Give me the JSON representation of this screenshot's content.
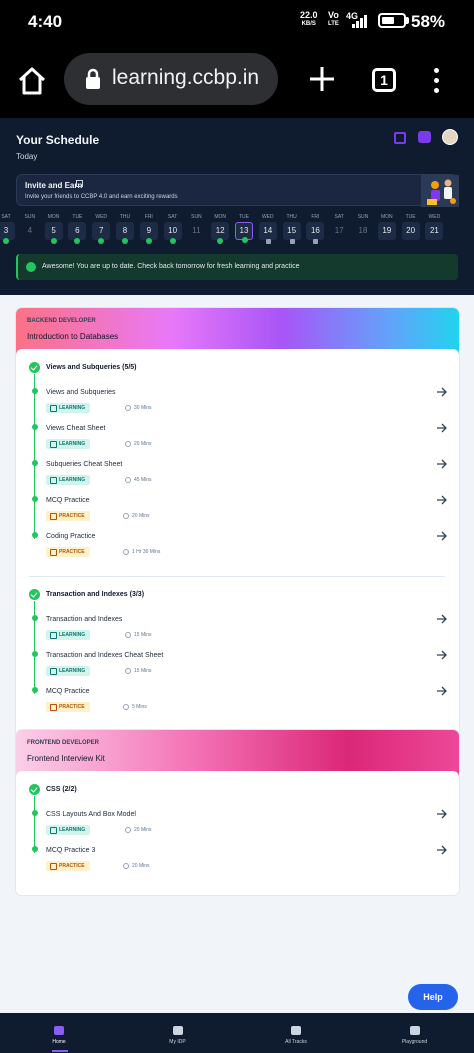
{
  "status_bar": {
    "time": "4:40",
    "speed_value": "22.0",
    "speed_unit": "KB/S",
    "volte_top": "Vo",
    "volte_bottom": "LTE",
    "network": "4G",
    "battery_percent": "58%",
    "battery_level": 0.58
  },
  "browser": {
    "url": "learning.ccbp.in",
    "tab_count": "1"
  },
  "schedule": {
    "title": "Your Schedule",
    "subtitle": "Today",
    "invite_title": "Invite and Earn",
    "invite_desc": "Invite your friends to CCBP 4.0 and earn exciting rewards",
    "days": [
      {
        "name": "SAT",
        "num": "3",
        "state": "done"
      },
      {
        "name": "SUN",
        "num": "4",
        "state": "off"
      },
      {
        "name": "MON",
        "num": "5",
        "state": "done"
      },
      {
        "name": "TUE",
        "num": "6",
        "state": "done"
      },
      {
        "name": "WED",
        "num": "7",
        "state": "done"
      },
      {
        "name": "THU",
        "num": "8",
        "state": "done"
      },
      {
        "name": "FRI",
        "num": "9",
        "state": "done"
      },
      {
        "name": "SAT",
        "num": "10",
        "state": "done"
      },
      {
        "name": "SUN",
        "num": "11",
        "state": "off"
      },
      {
        "name": "MON",
        "num": "12",
        "state": "done"
      },
      {
        "name": "TUE",
        "num": "13",
        "state": "today"
      },
      {
        "name": "WED",
        "num": "14",
        "state": "locked"
      },
      {
        "name": "THU",
        "num": "15",
        "state": "locked"
      },
      {
        "name": "FRI",
        "num": "16",
        "state": "locked"
      },
      {
        "name": "SAT",
        "num": "17",
        "state": "off"
      },
      {
        "name": "SUN",
        "num": "18",
        "state": "off"
      },
      {
        "name": "MON",
        "num": "19",
        "state": "plain"
      },
      {
        "name": "TUE",
        "num": "20",
        "state": "plain"
      },
      {
        "name": "WED",
        "num": "21",
        "state": "plain"
      }
    ],
    "status_message": "Awesome! You are up to date. Check back tomorrow for fresh learning and practice"
  },
  "cards": [
    {
      "category": "BACKEND DEVELOPER",
      "title": "Introduction to Databases",
      "sections": [
        {
          "title": "Views and Subqueries (5/5)",
          "items": [
            {
              "title": "Views and Subqueries",
              "type": "LEARNING",
              "duration": "30 Mins"
            },
            {
              "title": "Views Cheat Sheet",
              "type": "LEARNING",
              "duration": "20 Mins"
            },
            {
              "title": "Subqueries Cheat Sheet",
              "type": "LEARNING",
              "duration": "45 Mins"
            },
            {
              "title": "MCQ Practice",
              "type": "PRACTICE",
              "duration": "20 Mins"
            },
            {
              "title": "Coding Practice",
              "type": "PRACTICE",
              "duration": "1 Hr 30 Mins"
            }
          ]
        },
        {
          "title": "Transaction and Indexes (3/3)",
          "items": [
            {
              "title": "Transaction and Indexes",
              "type": "LEARNING",
              "duration": "15 Mins"
            },
            {
              "title": "Transaction and Indexes Cheat Sheet",
              "type": "LEARNING",
              "duration": "15 Mins"
            },
            {
              "title": "MCQ Practice",
              "type": "PRACTICE",
              "duration": "5 Mins"
            }
          ]
        }
      ]
    },
    {
      "category": "FRONTEND DEVELOPER",
      "title": "Frontend Interview Kit",
      "sections": [
        {
          "title": "CSS (2/2)",
          "items": [
            {
              "title": "CSS Layouts And Box Model",
              "type": "LEARNING",
              "duration": "20 Mins"
            },
            {
              "title": "MCQ Practice 3",
              "type": "PRACTICE",
              "duration": "20 Mins"
            }
          ]
        }
      ]
    }
  ],
  "help_label": "Help",
  "bottom_nav": [
    {
      "label": "Home",
      "icon": "home-icon",
      "active": true
    },
    {
      "label": "My IDP",
      "icon": "idp-icon",
      "active": false
    },
    {
      "label": "All Tracks",
      "icon": "tracks-icon",
      "active": false
    },
    {
      "label": "Playground",
      "icon": "terminal-icon",
      "active": false
    }
  ],
  "colors": {
    "accent": "#8b5cf6",
    "success": "#22c55e",
    "help": "#2563eb",
    "header_bg": "#0f1b2e"
  }
}
